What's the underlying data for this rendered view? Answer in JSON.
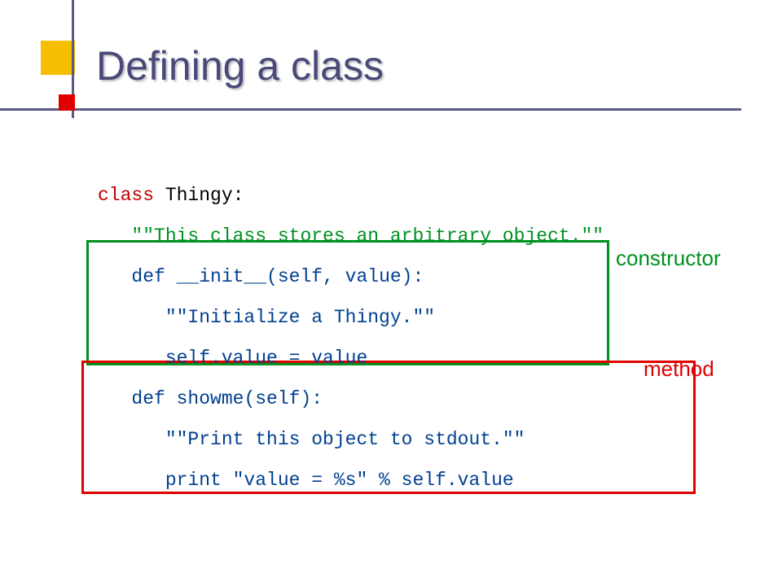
{
  "title": "Defining a class",
  "labels": {
    "constructor": "constructor",
    "method": "method"
  },
  "code": {
    "l1": {
      "kw": "class ",
      "name": "Thingy:"
    },
    "l2": "   \"\"This class stores an arbitrary object.\"\"",
    "l3": {
      "kw": "   def ",
      "name": "__init__",
      "rest": "(self, value):"
    },
    "l4": "      \"\"Initialize a Thingy.\"\"",
    "l5": "      self.value = value",
    "l6": {
      "kw": "   def ",
      "name": "showme",
      "rest": "(self):"
    },
    "l7": "      \"\"Print this object to stdout.\"\"",
    "l8": "      print \"value = %s\" % self.value"
  }
}
